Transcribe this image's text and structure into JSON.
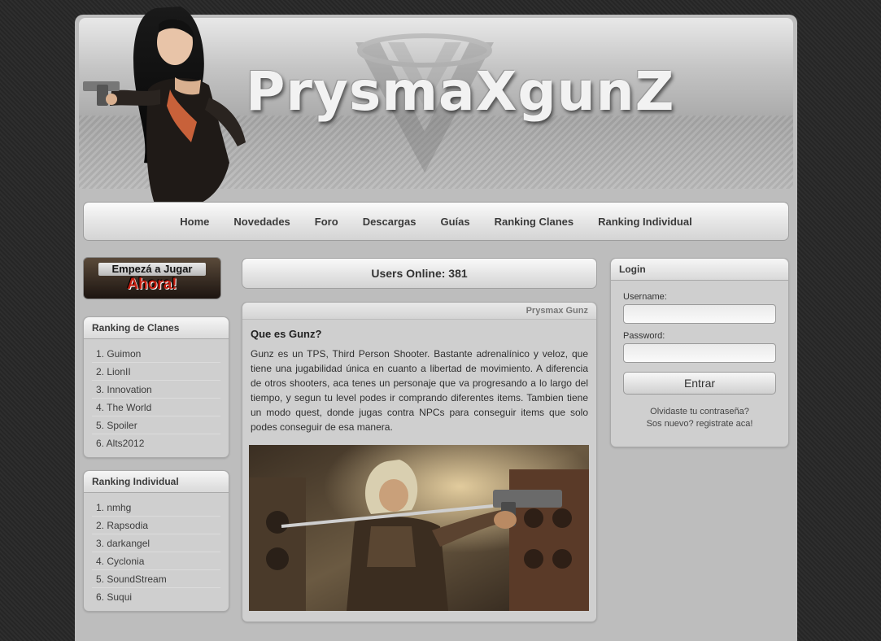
{
  "site": {
    "title": "PrysmaXgunZ"
  },
  "nav": {
    "items": [
      "Home",
      "Novedades",
      "Foro",
      "Descargas",
      "Guías",
      "Ranking Clanes",
      "Ranking Individual"
    ]
  },
  "play_banner": {
    "line1": "Empezá a Jugar",
    "line2": "Ahora!"
  },
  "ranking_clanes": {
    "title": "Ranking de Clanes",
    "items": [
      "1. Guimon",
      "2. LionII",
      "3. Innovation",
      "4. The World",
      "5. Spoiler",
      "6. Alts2012"
    ]
  },
  "ranking_individual": {
    "title": "Ranking Individual",
    "items": [
      "1. nmhg",
      "2. Rapsodia",
      "3. darkangel",
      "4. Cyclonia",
      "5. SoundStream",
      "6. Suqui"
    ]
  },
  "users_online": "Users Online: 381",
  "article": {
    "tag": "Prysmax Gunz",
    "title": "Que es Gunz?",
    "body": "Gunz es un TPS, Third Person Shooter. Bastante adrenalínico y veloz, que tiene una jugabilidad única en cuanto a libertad de movimiento. A diferencia de otros shooters, aca tenes un personaje que va progresando a lo largo del tiempo, y segun tu level podes ir comprando diferentes items. Tambien tiene un modo quest, donde jugas contra NPCs para conseguir items que solo podes conseguir de esa manera."
  },
  "login": {
    "title": "Login",
    "username_label": "Username:",
    "password_label": "Password:",
    "submit": "Entrar",
    "forgot": "Olvidaste tu contraseña?",
    "register": "Sos nuevo? registrate aca!"
  }
}
